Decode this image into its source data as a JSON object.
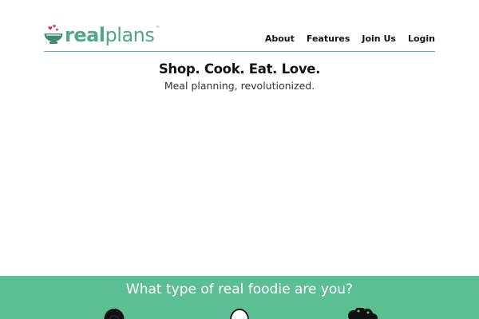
{
  "brand": {
    "logo_real": "real",
    "logo_plans": "plans",
    "trademark": "™",
    "accent_color": "#5bbf93",
    "heart_color": "#e0245e"
  },
  "nav": {
    "items": [
      {
        "label": "About"
      },
      {
        "label": "Features"
      },
      {
        "label": "Join Us"
      },
      {
        "label": "Login"
      }
    ]
  },
  "hero": {
    "title": "Shop. Cook. Eat. Love.",
    "subtitle": "Meal planning, revolutionized."
  },
  "foodie_section": {
    "title": "What type of real foodie are you?",
    "icons": [
      "avocado-icon",
      "egg-icon",
      "broccoli-icon"
    ]
  }
}
